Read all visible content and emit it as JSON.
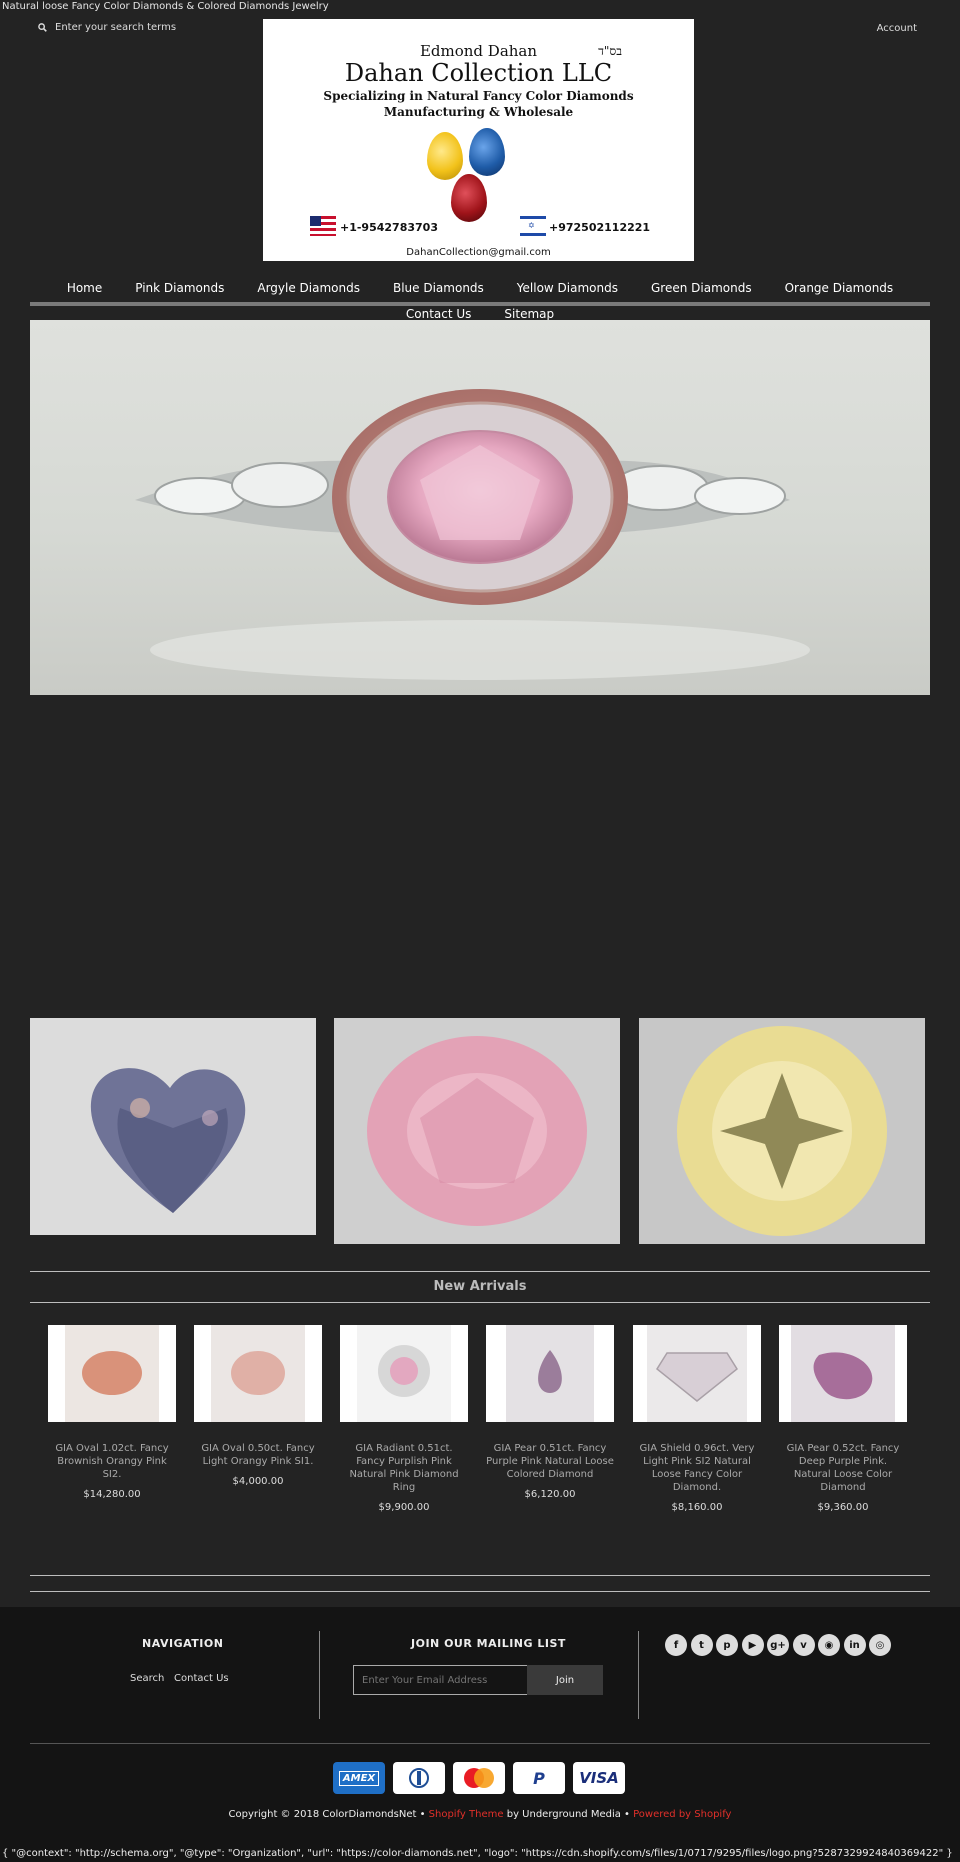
{
  "page_title": "Natural loose Fancy Color Diamonds & Colored Diamonds Jewelry",
  "search": {
    "placeholder": "Enter your search terms",
    "icon": "search-icon"
  },
  "account_label": "Account",
  "logo": {
    "line1": "Edmond Dahan",
    "hebrew": "בס\"ד",
    "line2": "Dahan Collection LLC",
    "line3": "Specializing in Natural Fancy Color Diamonds",
    "line4": "Manufacturing & Wholesale",
    "phone_us": "+1-9542783703",
    "phone_il": "+972502112221",
    "email": "DahanCollection@gmail.com",
    "gem_colors": [
      "#f2c21a",
      "#1f5ca8",
      "#a0141a"
    ]
  },
  "nav": {
    "row1": [
      "Home",
      "Pink Diamonds",
      "Argyle Diamonds",
      "Blue Diamonds",
      "Yellow Diamonds",
      "Green Diamonds",
      "Orange Diamonds"
    ],
    "row2": [
      "Contact Us",
      "Sitemap"
    ]
  },
  "new_arrivals": {
    "title": "New Arrivals",
    "products": [
      {
        "name": "GIA Oval 1.02ct. Fancy Brownish Orangy Pink SI2.",
        "price": "$14,280.00",
        "color": "#d9927a"
      },
      {
        "name": "GIA Oval 0.50ct. Fancy Light Orangy Pink SI1.",
        "price": "$4,000.00",
        "color": "#e0b0a6"
      },
      {
        "name": "GIA Radiant 0.51ct. Fancy Purplish Pink Natural Pink Diamond Ring",
        "price": "$9,900.00",
        "color": "#e3a8c0"
      },
      {
        "name": "GIA Pear 0.51ct. Fancy Purple Pink Natural Loose Colored Diamond",
        "price": "$6,120.00",
        "color": "#9b7d9b"
      },
      {
        "name": "GIA Shield 0.96ct. Very Light Pink SI2 Natural Loose Fancy Color Diamond.",
        "price": "$8,160.00",
        "color": "#d8cfd6"
      },
      {
        "name": "GIA Pear 0.52ct. Fancy Deep Purple Pink. Natural Loose Color Diamond",
        "price": "$9,360.00",
        "color": "#a76e9a"
      }
    ]
  },
  "footer": {
    "nav_heading": "NAVIGATION",
    "nav_links": [
      "Search",
      "Contact Us"
    ],
    "mailing_heading": "JOIN OUR MAILING LIST",
    "email_placeholder": "Enter Your Email Address",
    "join_label": "Join",
    "social_icons": [
      "facebook-icon",
      "twitter-icon",
      "pinterest-icon",
      "youtube-icon",
      "google-plus-icon",
      "vimeo-icon",
      "rss-icon",
      "linkedin-icon",
      "instagram-icon"
    ],
    "social_glyphs": [
      "f",
      "t",
      "p",
      "▶",
      "g+",
      "v",
      "◉",
      "in",
      "◎"
    ],
    "payment": [
      "AMEX",
      "DINERS",
      "MASTERCARD",
      "PayPal",
      "VISA"
    ],
    "copyright_prefix": "Copyright © 2018 ColorDiamondsNet •",
    "theme_link": "Shopify Theme",
    "theme_by": "by Underground Media •",
    "powered_link": "Powered by Shopify"
  },
  "schema_text": "{ \"@context\": \"http://schema.org\", \"@type\": \"Organization\", \"url\": \"https://color-diamonds.net\", \"logo\": \"https://cdn.shopify.com/s/files/1/0717/9295/files/logo.png?5287329924840369422\" }"
}
